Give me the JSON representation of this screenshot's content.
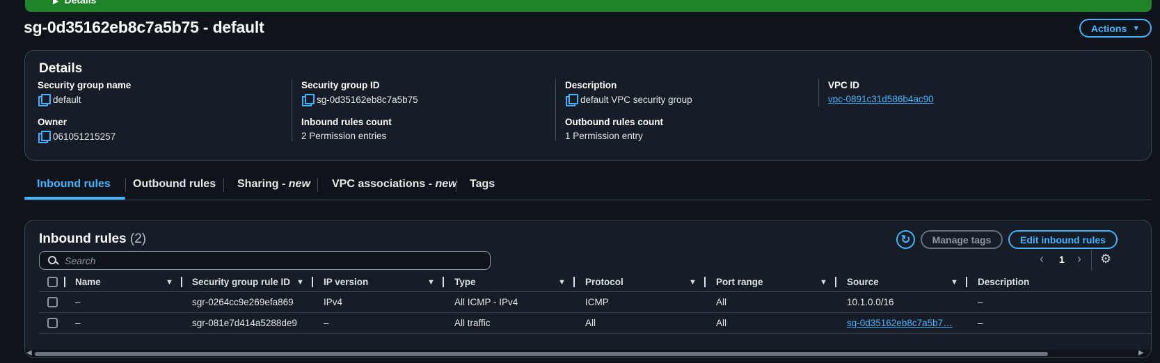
{
  "flash": {
    "label": "Details"
  },
  "page": {
    "title": "sg-0d35162eb8c7a5b75 - default",
    "actions_label": "Actions"
  },
  "details": {
    "heading": "Details",
    "fields": {
      "sg_name": {
        "label": "Security group name",
        "value": "default"
      },
      "sg_id": {
        "label": "Security group ID",
        "value": "sg-0d35162eb8c7a5b75"
      },
      "description": {
        "label": "Description",
        "value": "default VPC security group"
      },
      "vpc_id": {
        "label": "VPC ID",
        "value": "vpc-0891c31d586b4ac90"
      },
      "owner": {
        "label": "Owner",
        "value": "061051215257"
      },
      "inbound_count": {
        "label": "Inbound rules count",
        "value": "2 Permission entries"
      },
      "outbound_count": {
        "label": "Outbound rules count",
        "value": "1 Permission entry"
      }
    }
  },
  "tabs": {
    "inbound": "Inbound rules",
    "outbound": "Outbound rules",
    "sharing": "Sharing - ",
    "sharing_new": "new",
    "vpc_assoc": "VPC associations - ",
    "vpc_assoc_new": "new",
    "tags": "Tags"
  },
  "rules": {
    "title": "Inbound rules",
    "count": "(2)",
    "manage_tags_label": "Manage tags",
    "edit_label": "Edit inbound rules",
    "search_placeholder": "Search",
    "page_number": "1",
    "columns": {
      "name": "Name",
      "rule_id": "Security group rule ID",
      "ip_version": "IP version",
      "type": "Type",
      "protocol": "Protocol",
      "port_range": "Port range",
      "source": "Source",
      "description": "Description"
    },
    "rows": [
      {
        "name": "–",
        "rule_id": "sgr-0264cc9e269efa869",
        "ip_version": "IPv4",
        "type": "All ICMP - IPv4",
        "protocol": "ICMP",
        "port_range": "All",
        "source": "10.1.0.0/16",
        "description": "–"
      },
      {
        "name": "–",
        "rule_id": "sgr-081e7d414a5288de9",
        "ip_version": "–",
        "type": "All traffic",
        "protocol": "All",
        "port_range": "All",
        "source": "sg-0d35162eb8c7a5b7…",
        "description": "–"
      }
    ]
  },
  "icons": {
    "copy": "copy-icon",
    "refresh": "refresh-icon",
    "search": "search-icon",
    "settings": "gear-icon"
  },
  "colors": {
    "accent": "#42b4ff",
    "success_banner": "#1f8427",
    "background": "#0f141a",
    "panel": "#161d26"
  }
}
